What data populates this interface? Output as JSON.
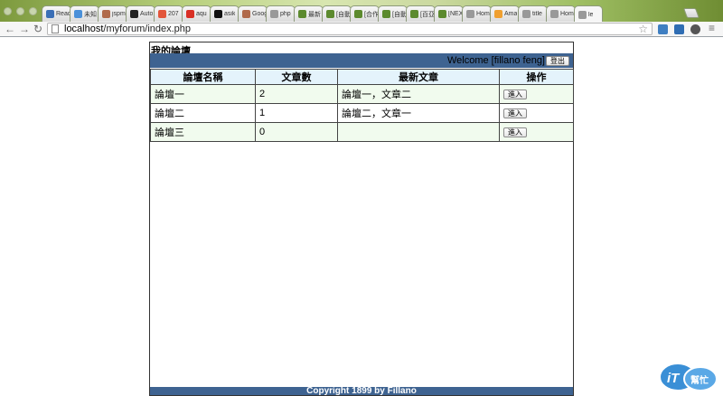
{
  "browser": {
    "tabs": [
      {
        "label": "Read",
        "icon": "home-icon",
        "color": "#3b6fb6"
      },
      {
        "label": "未知",
        "icon": "page-icon",
        "color": "#4a90d9"
      },
      {
        "label": "jspm",
        "icon": "globe-icon",
        "color": "#b06a4b"
      },
      {
        "label": "Auto",
        "icon": "app-icon",
        "color": "#222222"
      },
      {
        "label": "207",
        "icon": "p-icon",
        "color": "#e2553a"
      },
      {
        "label": "aqu",
        "icon": "gmail-icon",
        "color": "#d93025"
      },
      {
        "label": "asik",
        "icon": "github-icon",
        "color": "#111111"
      },
      {
        "label": "Goog",
        "icon": "globe-icon",
        "color": "#b06a4b"
      },
      {
        "label": "php",
        "icon": "page-icon",
        "color": "#999999"
      },
      {
        "label": "最新",
        "icon": "leaf-icon",
        "color": "#5c8a2e"
      },
      {
        "label": "[自動",
        "icon": "leaf-icon",
        "color": "#5c8a2e"
      },
      {
        "label": "[合作",
        "icon": "leaf-icon",
        "color": "#5c8a2e"
      },
      {
        "label": "[自動",
        "icon": "leaf-icon",
        "color": "#5c8a2e"
      },
      {
        "label": "[百亞",
        "icon": "leaf-icon",
        "color": "#5c8a2e"
      },
      {
        "label": "[NEX",
        "icon": "leaf-icon",
        "color": "#5c8a2e"
      },
      {
        "label": "Hom",
        "icon": "page-icon",
        "color": "#999999"
      },
      {
        "label": "Ama",
        "icon": "amazon-icon",
        "color": "#f0a030"
      },
      {
        "label": "title",
        "icon": "page-icon",
        "color": "#999999"
      },
      {
        "label": "Hom",
        "icon": "page-icon",
        "color": "#999999"
      },
      {
        "label": "le",
        "icon": "page-icon",
        "color": "#999999",
        "active": true
      }
    ],
    "url_host": "localhost",
    "url_path": "/myforum/index.php"
  },
  "page": {
    "title": "我的論壇",
    "welcome": "Welcome [fillano feng]",
    "logout_label": "登出",
    "table": {
      "headers": [
        "論壇名稱",
        "文章數",
        "最新文章",
        "操作"
      ],
      "rows": [
        {
          "name": "論壇一",
          "count": "2",
          "latest": "論壇一，文章二",
          "action": "進入"
        },
        {
          "name": "論壇二",
          "count": "1",
          "latest": "論壇二，文章一",
          "action": "進入"
        },
        {
          "name": "論壇三",
          "count": "0",
          "latest": "",
          "action": "進入"
        }
      ]
    },
    "footer": "Copyright 1899 by Fillano"
  },
  "colors": {
    "bar_blue": "#3e6391",
    "header_bg": "#e4f3fb",
    "row_bg": "#f1fbee"
  }
}
